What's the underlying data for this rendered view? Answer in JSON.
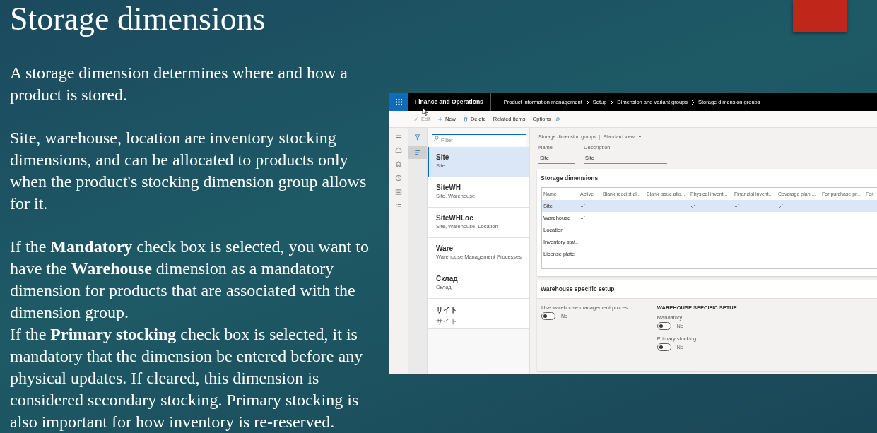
{
  "slide": {
    "title": "Storage dimensions",
    "blocks": [
      [
        "A storage dimension determines where and how a product is stored."
      ],
      [
        "Site, warehouse, location are inventory stocking dimensions, and can be allocated to products only when the product's stocking dimension group allows for it."
      ],
      [
        "If the **Mandatory** check box is selected, you want to have the **Warehouse** dimension as a mandatory dimension for products that are associated with the dimension group.",
        "If the **Primary stocking** check box is selected, it is mandatory that the dimension be entered before any physical updates. If cleared, this dimension is considered secondary stocking. Primary stocking is also important for how inventory is re-reserved."
      ]
    ]
  },
  "app": {
    "app_name": "Finance and Operations",
    "breadcrumb": [
      "Product information management",
      "Setup",
      "Dimension and variant groups",
      "Storage dimension groups"
    ],
    "toolbar": [
      {
        "label": "Edit",
        "kind": "edit",
        "disabled": true
      },
      {
        "label": "New",
        "kind": "new",
        "disabled": false
      },
      {
        "label": "Delete",
        "kind": "delete",
        "disabled": false
      },
      {
        "label": "Related items",
        "kind": "text",
        "disabled": false
      },
      {
        "label": "Options",
        "kind": "text",
        "disabled": false
      }
    ],
    "nav": [
      {
        "kind": "menu"
      },
      {
        "kind": "home"
      },
      {
        "kind": "star"
      },
      {
        "kind": "clock"
      },
      {
        "kind": "workspace"
      },
      {
        "kind": "list"
      }
    ],
    "filter_strip": [
      {
        "kind": "filter",
        "selected": false
      },
      {
        "kind": "list",
        "selected": true
      }
    ],
    "filter": {
      "placeholder": "Filter"
    },
    "list": [
      {
        "title": "Site",
        "subtitle": "Site",
        "selected": true
      },
      {
        "title": "SiteWH",
        "subtitle": "Site, Warehouse",
        "selected": false
      },
      {
        "title": "SiteWHLoc",
        "subtitle": "Site, Warehouse, Location",
        "selected": false
      },
      {
        "title": "Ware",
        "subtitle": "Warehouse Management Processes",
        "selected": false
      },
      {
        "title": "Склад",
        "subtitle": "Склад",
        "selected": false
      },
      {
        "title": "サイト",
        "subtitle": "サイト",
        "selected": false
      }
    ],
    "view_header": {
      "title": "Storage dimension groups",
      "separator": "|",
      "view": "Standard view"
    },
    "fields": [
      {
        "label": "Name",
        "value": "Site"
      },
      {
        "label": "Description",
        "value": "Site"
      }
    ],
    "dimensions": {
      "title": "Storage dimensions",
      "columns": [
        "Name",
        "Active",
        "Blank receipt al...",
        "Blank issue allo...",
        "Physical invent...",
        "Financial invent...",
        "Coverage plan ...",
        "For purchase pr...",
        "For"
      ],
      "rows": [
        {
          "name": "Site",
          "selected": true,
          "checks": [
            true,
            false,
            false,
            true,
            true,
            true,
            false,
            false
          ]
        },
        {
          "name": "Warehouse",
          "selected": false,
          "checks": [
            true,
            false,
            false,
            false,
            false,
            false,
            false,
            false
          ]
        },
        {
          "name": "Location",
          "selected": false,
          "checks": [
            false,
            false,
            false,
            false,
            false,
            false,
            false,
            false
          ]
        },
        {
          "name": "Inventory stat...",
          "selected": false,
          "checks": [
            false,
            false,
            false,
            false,
            false,
            false,
            false,
            false
          ]
        },
        {
          "name": "License plate",
          "selected": false,
          "checks": [
            false,
            false,
            false,
            false,
            false,
            false,
            false,
            false
          ]
        }
      ]
    },
    "warehouse_setup": {
      "title": "Warehouse specific setup",
      "use_wms": {
        "label": "Use warehouse management proces...",
        "on": false,
        "value": "No"
      },
      "section": "WAREHOUSE SPECIFIC SETUP",
      "toggles": [
        {
          "label": "Mandatory",
          "on": false,
          "value": "No"
        },
        {
          "label": "Primary stocking",
          "on": false,
          "value": "No"
        }
      ]
    }
  }
}
